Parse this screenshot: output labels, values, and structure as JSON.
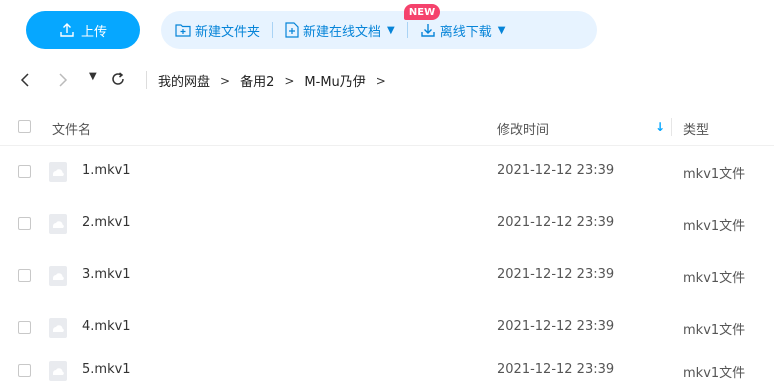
{
  "toolbar": {
    "upload_label": "上传",
    "new_folder_label": "新建文件夹",
    "new_online_doc_label": "新建在线文档",
    "new_badge": "NEW",
    "offline_download_label": "离线下载"
  },
  "breadcrumb": {
    "items": [
      "我的网盘",
      "备用2",
      "M-Mu乃伊"
    ],
    "separator": ">"
  },
  "table": {
    "headers": {
      "name": "文件名",
      "modified": "修改时间",
      "type": "类型"
    },
    "rows": [
      {
        "name": "1.mkv1",
        "modified": "2021-12-12 23:39",
        "type": "mkv1文件"
      },
      {
        "name": "2.mkv1",
        "modified": "2021-12-12 23:39",
        "type": "mkv1文件"
      },
      {
        "name": "3.mkv1",
        "modified": "2021-12-12 23:39",
        "type": "mkv1文件"
      },
      {
        "name": "4.mkv1",
        "modified": "2021-12-12 23:39",
        "type": "mkv1文件"
      },
      {
        "name": "5.mkv1",
        "modified": "2021-12-12 23:39",
        "type": "mkv1文件"
      }
    ]
  },
  "colors": {
    "accent": "#06a7ff",
    "action_bar_bg": "#e7f3ff",
    "badge": "#f5426c"
  }
}
